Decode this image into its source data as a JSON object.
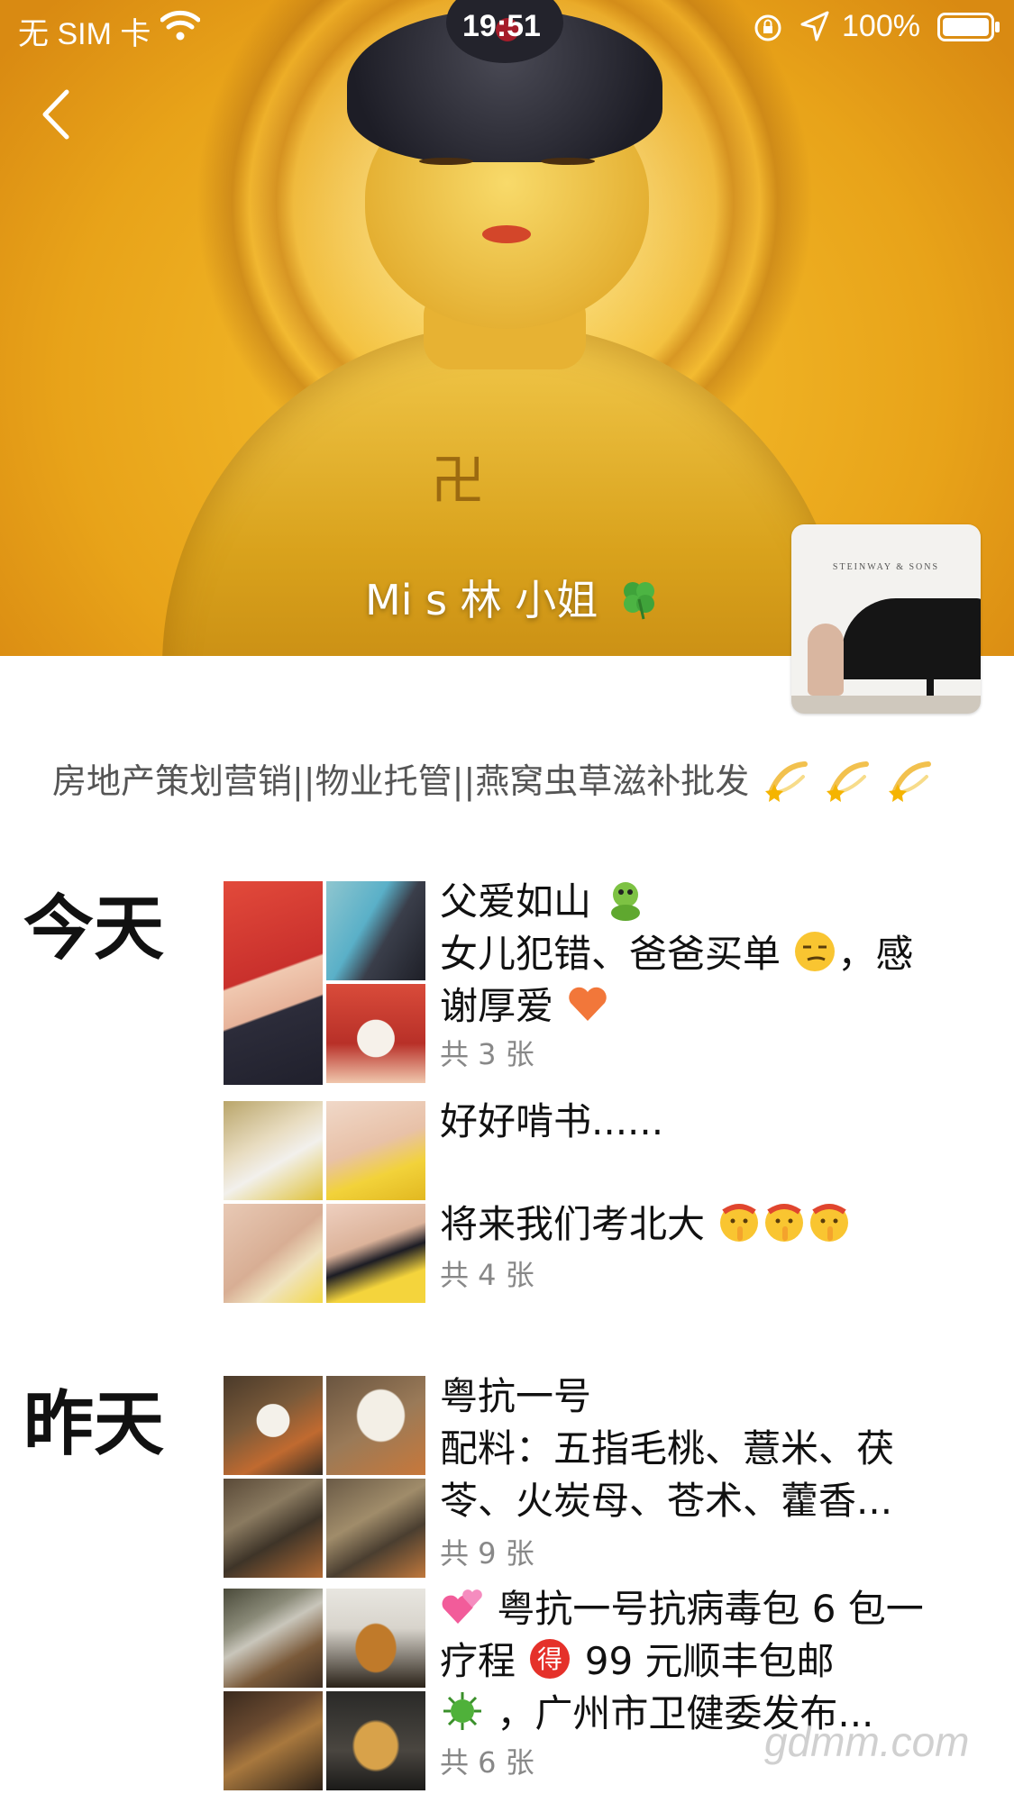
{
  "status_bar": {
    "carrier": "无 SIM 卡",
    "time": "19:51",
    "battery": "100%"
  },
  "profile": {
    "nickname": "Mi s 林 小姐",
    "signature": "房地产策划营销||物业托管||燕窝虫草滋补批发",
    "avatar_brand_text": "STEINWAY & SONS"
  },
  "feed": {
    "days": [
      {
        "label": "今天",
        "posts": [
          {
            "lines": [
              "父爱如山",
              "女儿犯错、爸爸买单",
              "，感",
              "谢厚爱"
            ],
            "count": "共 3 张"
          },
          {
            "lines": [
              "好好啃书......",
              "将来我们考北大"
            ],
            "count": "共 4 张"
          }
        ]
      },
      {
        "label": "昨天",
        "posts": [
          {
            "lines": [
              "粤抗一号",
              "配料：五指毛桃、薏米、茯",
              "苓、火炭母、苍术、藿香..."
            ],
            "count": "共 9 张"
          },
          {
            "lines": [
              "粤抗一号抗病毒包 6 包一",
              "疗程",
              "99 元顺丰包邮",
              "，广州市卫健委发布..."
            ],
            "count": "共 6 张"
          }
        ]
      }
    ]
  },
  "watermark": "gdmm.com",
  "colors": {
    "cover_gold": "#f2b52a",
    "post_count_gray": "#888888",
    "signature_gray": "#555555"
  }
}
